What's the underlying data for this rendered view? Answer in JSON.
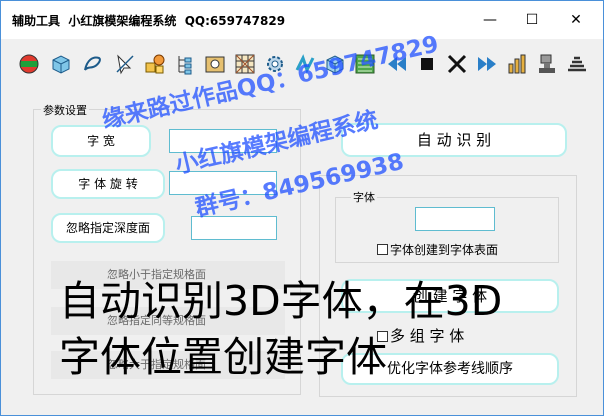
{
  "window": {
    "title": "辅助工具  小红旗模架编程系统  QQ:659747829",
    "minimize_glyph": "—",
    "maximize_glyph": "☐",
    "close_glyph": "✕"
  },
  "toolbar": {
    "icons": [
      "ball-icon",
      "box-icon",
      "curve-icon",
      "pointer-icon",
      "shapes-icon",
      "tree-icon",
      "gear-box-icon",
      "grid-icon",
      "settings-icon",
      "spring-icon",
      "cube-icon",
      "layers-icon",
      "rewind-icon",
      "stop-icon",
      "split-icon",
      "forward-icon",
      "chart-icon",
      "stamp-icon",
      "stack-icon"
    ]
  },
  "params_group": {
    "label": "参数设置",
    "btn_char_width": "字  宽",
    "btn_char_rotate": "字 体 旋 转",
    "btn_ignore_depth": "忽略指定深度面",
    "row_ignore_less": "忽略小于指定规格面",
    "row_ignore_same": "忽略指定同等规格面",
    "row_ignore_greater": "忽略大于指定规格面"
  },
  "auto_recognize_button": "自    动    识    别",
  "font_group": {
    "label": "字体",
    "checkbox_surface": "字体创建到字体表面",
    "btn_create_font": "创    建    字    体",
    "checkbox_multi": "多  组  字  体",
    "btn_optimize": "优化字体参考线顺序"
  },
  "watermark": {
    "line1": "缘来路过作品QQ：659747829",
    "line2": "小红旗模架编程系统",
    "line3": "群号：849569938"
  },
  "overlay": {
    "line1": "自动识别3D字体，在3D",
    "line2": "字体位置创建字体"
  }
}
